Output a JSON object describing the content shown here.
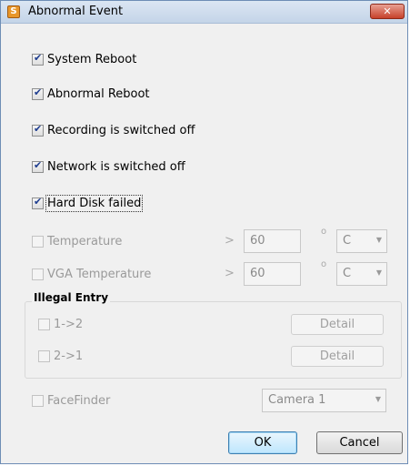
{
  "window": {
    "title": "Abnormal Event",
    "close_glyph": "✕"
  },
  "options": [
    {
      "label": "System Reboot",
      "checked": true
    },
    {
      "label": "Abnormal Reboot",
      "checked": true
    },
    {
      "label": "Recording is switched off",
      "checked": true
    },
    {
      "label": "Network is switched off",
      "checked": true
    },
    {
      "label": "Hard Disk failed",
      "checked": true
    }
  ],
  "temperature": {
    "label": "Temperature",
    "operator": ">",
    "value": "60",
    "unit_symbol": "o",
    "unit": "C"
  },
  "vga_temperature": {
    "label": "VGA Temperature",
    "operator": ">",
    "value": "60",
    "unit_symbol": "o",
    "unit": "C"
  },
  "illegal_entry": {
    "title": "Illegal Entry",
    "items": [
      {
        "label": "1->2",
        "button": "Detail"
      },
      {
        "label": "2->1",
        "button": "Detail"
      }
    ]
  },
  "facefinder": {
    "label": "FaceFinder",
    "camera": "Camera 1"
  },
  "buttons": {
    "ok": "OK",
    "cancel": "Cancel"
  },
  "dropdown_arrow": "▼"
}
